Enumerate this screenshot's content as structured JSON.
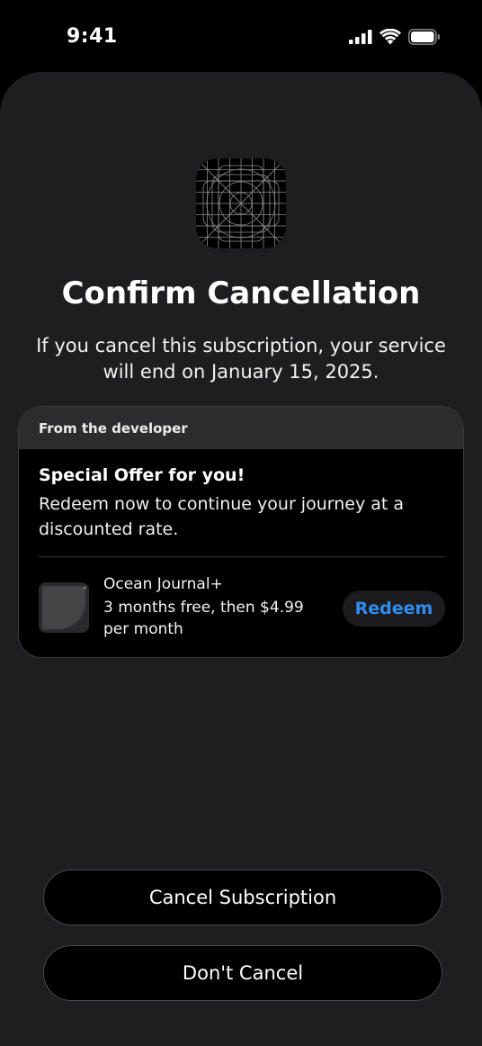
{
  "status_bar": {
    "time": "9:41",
    "icons": [
      "cellular-signal-icon",
      "wifi-icon",
      "battery-icon"
    ]
  },
  "sheet": {
    "app_icon": "app-icon-placeholder-grid",
    "title": "Confirm Cancellation",
    "subtitle": "If you cancel this subscription, your service will end on January 15, 2025."
  },
  "offer": {
    "header": "From the developer",
    "headline": "Special Offer for you!",
    "description": "Redeem now to continue your journey at a discounted rate.",
    "product_name": "Ocean Journal+",
    "product_terms": "3 months free, then $4.99 per month",
    "redeem_label": "Redeem"
  },
  "actions": {
    "cancel_subscription_label": "Cancel Subscription",
    "dont_cancel_label": "Don't Cancel"
  },
  "colors": {
    "background": "#000000",
    "sheet": "#1e1e20",
    "card_header": "#2c2c2e",
    "accent": "#2f8cf0"
  }
}
